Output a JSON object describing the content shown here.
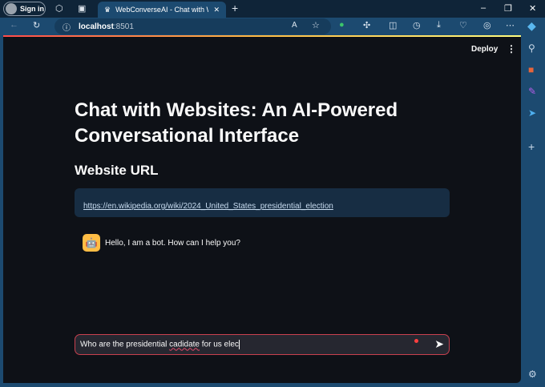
{
  "browser": {
    "sign_in": "Sign in",
    "tab_title": "WebConverseAI - Chat with Websites",
    "address_host": "localhost",
    "address_port": ":8501"
  },
  "app": {
    "deploy": "Deploy",
    "menu": "⋮",
    "title": "Chat with Websites: An AI-Powered Conversational Interface",
    "url_heading": "Website URL",
    "url_value": "https://en.wikipedia.org/wiki/2024_United_States_presidential_election"
  },
  "messages": [
    {
      "role": "bot",
      "text": "Hello, I am a bot. How can I help you?"
    }
  ],
  "chat_input": {
    "before": "Who are the presidential ",
    "typo": "cadidate",
    "after": " for us elec"
  },
  "colors": {
    "accent": "#ff4b4b",
    "bg": "#0e1117",
    "chrome": "#1c4a70"
  }
}
